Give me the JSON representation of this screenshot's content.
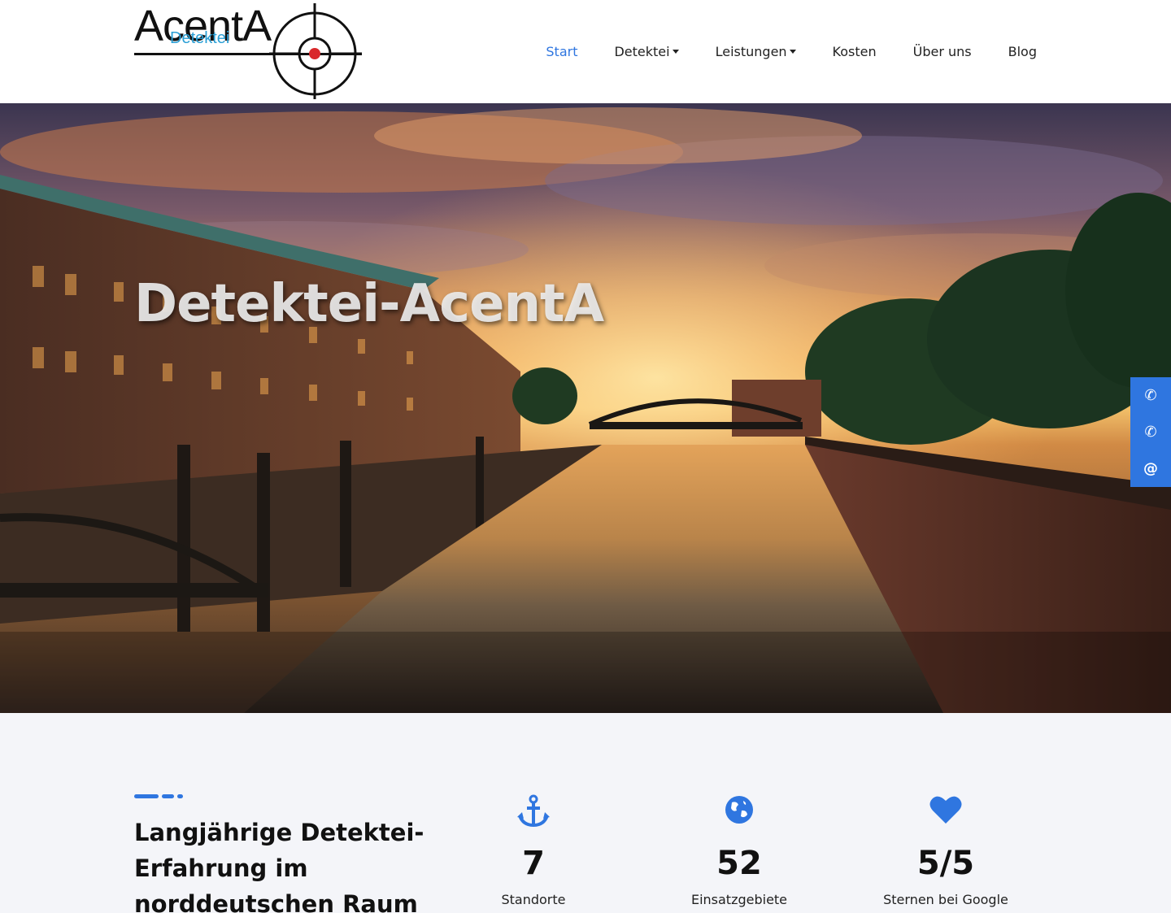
{
  "logo": {
    "main_text": "AcentA",
    "sub_text": "Detektei"
  },
  "nav": {
    "items": [
      {
        "label": "Start",
        "active": true,
        "dropdown": false
      },
      {
        "label": "Detektei",
        "active": false,
        "dropdown": true
      },
      {
        "label": "Leistungen",
        "active": false,
        "dropdown": true
      },
      {
        "label": "Kosten",
        "active": false,
        "dropdown": false
      },
      {
        "label": "Über uns",
        "active": false,
        "dropdown": false
      },
      {
        "label": "Blog",
        "active": false,
        "dropdown": false
      }
    ]
  },
  "hero": {
    "title": "Detektei-AcentA"
  },
  "side_contact": {
    "buttons": [
      {
        "icon": "phone-icon",
        "glyph": "✆"
      },
      {
        "icon": "phone-icon",
        "glyph": "✆"
      },
      {
        "icon": "email-icon",
        "glyph": "@"
      }
    ]
  },
  "stats": {
    "heading": "Langjährige Detektei-Erfahrung im norddeutschen Raum",
    "items": [
      {
        "icon": "anchor-icon",
        "value": "7",
        "label": "Standorte"
      },
      {
        "icon": "globe-icon",
        "value": "52",
        "label": "Einsatzgebiete"
      },
      {
        "icon": "heart-icon",
        "value": "5/5",
        "label": "Sternen bei Google"
      }
    ]
  },
  "colors": {
    "accent": "#2f76e0",
    "logo_blue": "#2a9fd6",
    "target_red": "#d9282b",
    "section_bg": "#f4f5f9"
  }
}
